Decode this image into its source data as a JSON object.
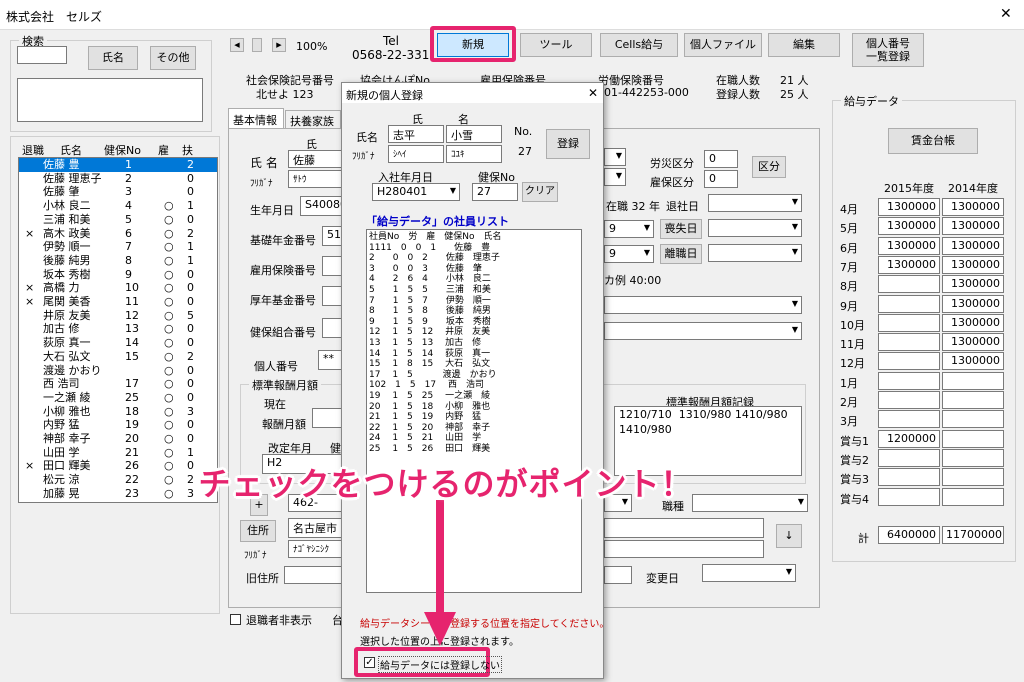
{
  "window": {
    "title": "株式会社　セルズ",
    "close": "✕"
  },
  "search": {
    "label": "検索",
    "name_btn": "氏名",
    "other_btn": "その他"
  },
  "staff_list": {
    "headers": [
      "退職",
      "氏名",
      "健保No",
      "雇",
      "扶"
    ],
    "rows": [
      {
        "ret": "",
        "name": "佐藤 豊",
        "no": "1",
        "koyo": "",
        "fu": "2"
      },
      {
        "ret": "",
        "name": "佐藤 理恵子",
        "no": "2",
        "koyo": "",
        "fu": "0"
      },
      {
        "ret": "",
        "name": "佐藤 肇",
        "no": "3",
        "koyo": "",
        "fu": "0"
      },
      {
        "ret": "",
        "name": "小林 良二",
        "no": "4",
        "koyo": "○",
        "fu": "1"
      },
      {
        "ret": "",
        "name": "三浦 和美",
        "no": "5",
        "koyo": "○",
        "fu": "0"
      },
      {
        "ret": "×",
        "name": "高木 政美",
        "no": "6",
        "koyo": "○",
        "fu": "2"
      },
      {
        "ret": "",
        "name": "伊勢 順一",
        "no": "7",
        "koyo": "○",
        "fu": "1"
      },
      {
        "ret": "",
        "name": "後藤 純男",
        "no": "8",
        "koyo": "○",
        "fu": "1"
      },
      {
        "ret": "",
        "name": "坂本 秀樹",
        "no": "9",
        "koyo": "○",
        "fu": "0"
      },
      {
        "ret": "×",
        "name": "高橋 力",
        "no": "10",
        "koyo": "○",
        "fu": "0"
      },
      {
        "ret": "×",
        "name": "尾関 美香",
        "no": "11",
        "koyo": "○",
        "fu": "0"
      },
      {
        "ret": "",
        "name": "井原 友美",
        "no": "12",
        "koyo": "○",
        "fu": "5"
      },
      {
        "ret": "",
        "name": "加古 修",
        "no": "13",
        "koyo": "○",
        "fu": "0"
      },
      {
        "ret": "",
        "name": "荻原 真一",
        "no": "14",
        "koyo": "○",
        "fu": "0"
      },
      {
        "ret": "",
        "name": "大石 弘文",
        "no": "15",
        "koyo": "○",
        "fu": "2"
      },
      {
        "ret": "",
        "name": "渡邊 かおり",
        "no": "",
        "koyo": "○",
        "fu": "0"
      },
      {
        "ret": "",
        "name": "西 浩司",
        "no": "17",
        "koyo": "○",
        "fu": "0"
      },
      {
        "ret": "",
        "name": "一之瀬 綾",
        "no": "25",
        "koyo": "○",
        "fu": "0"
      },
      {
        "ret": "",
        "name": "小柳 雅也",
        "no": "18",
        "koyo": "○",
        "fu": "3"
      },
      {
        "ret": "",
        "name": "内野 猛",
        "no": "19",
        "koyo": "○",
        "fu": "0"
      },
      {
        "ret": "",
        "name": "神部 幸子",
        "no": "20",
        "koyo": "○",
        "fu": "0"
      },
      {
        "ret": "",
        "name": "山田 学",
        "no": "21",
        "koyo": "○",
        "fu": "1"
      },
      {
        "ret": "×",
        "name": "田口 輝美",
        "no": "26",
        "koyo": "○",
        "fu": "0"
      },
      {
        "ret": "",
        "name": "松元 涼",
        "no": "22",
        "koyo": "○",
        "fu": "2"
      },
      {
        "ret": "",
        "name": "加藤 晃",
        "no": "23",
        "koyo": "○",
        "fu": "3"
      }
    ]
  },
  "toolbar": {
    "zoom": "100%",
    "tel_label": "Tel",
    "tel": "0568-22-3311",
    "new": "新規",
    "tool": "ツール",
    "cells_kyuyo": "Cells給与",
    "kojin_file": "個人ファイル",
    "henshu": "編集",
    "mynumber_list": "個人番号\n一覧登録"
  },
  "insurance": {
    "shaho_label": "社会保険記号番号",
    "shaho_val": "北せよ 123",
    "kyokai_label": "協会けんぽNo",
    "koyo_label": "雇用保険番号",
    "rodo_label": "労働保険番号",
    "rodo_val": "01-442253-000",
    "zaishoku_label": "在職人数",
    "zaishoku_val": "21 人",
    "toroku_label": "登録人数",
    "toroku_val": "25 人"
  },
  "tabs": [
    "基本情報",
    "扶養家族"
  ],
  "basic": {
    "shi": "氏",
    "shimei_label": "氏 名",
    "shimei_val": "佐藤",
    "furigana_label": "ﾌﾘｶﾞﾅ",
    "furigana_val": "ｻﾄｳ",
    "seinengappi": "生年月日",
    "seinen_val": "S40080",
    "kiso_label": "基礎年金番号",
    "kiso_val": "51",
    "koyo_no": "雇用保険番号",
    "kosei_no": "厚年基金番号",
    "kenpo_kumiai": "健保組合番号",
    "kojin_no": "個人番号",
    "kojin_val": "**",
    "rosai": "労災区分",
    "rosai_val": "0",
    "koyo_kubun": "雇保区分",
    "koyo_val": "0",
    "kubun_btn": "区分",
    "zaishoku_text": "在職 32 年",
    "taishokubi": "退社日",
    "sou9": "9",
    "sousitsu": "喪失日",
    "rishoku": "離職日",
    "hyojun_text": "カ例 40:00"
  },
  "hoshu": {
    "group": "標準報酬月額",
    "genzai": "現在",
    "hoshu_getsugaku": "報酬月額",
    "kaitei": "改定年月",
    "kaitei_val": "H2",
    "ken": "健",
    "kiroku_label": "標準報酬月額記録",
    "kiroku": "1210/710  1310/980 1410/980\n1410/980"
  },
  "address": {
    "jusho_btn": "住所",
    "jusho_val": "名古屋市",
    "furi": "ﾌﾘｶﾞﾅ",
    "furi_val": "ﾅｺﾞﾔｼﾆｼｸ",
    "kyu": "旧住所",
    "zip": "462-",
    "shokushu": "職種",
    "henkobi": "変更日",
    "arrow": "↓",
    "plus": "+"
  },
  "salary": {
    "title": "給与データ",
    "ledger_btn": "賃金台帳",
    "years": [
      "2015年度",
      "2014年度"
    ],
    "rows": [
      {
        "m": "4月",
        "a": "1300000",
        "b": "1300000"
      },
      {
        "m": "5月",
        "a": "1300000",
        "b": "1300000"
      },
      {
        "m": "6月",
        "a": "1300000",
        "b": "1300000"
      },
      {
        "m": "7月",
        "a": "1300000",
        "b": "1300000"
      },
      {
        "m": "8月",
        "a": "",
        "b": "1300000"
      },
      {
        "m": "9月",
        "a": "",
        "b": "1300000"
      },
      {
        "m": "10月",
        "a": "",
        "b": "1300000"
      },
      {
        "m": "11月",
        "a": "",
        "b": "1300000"
      },
      {
        "m": "12月",
        "a": "",
        "b": "1300000"
      },
      {
        "m": "1月",
        "a": "",
        "b": ""
      },
      {
        "m": "2月",
        "a": "",
        "b": ""
      },
      {
        "m": "3月",
        "a": "",
        "b": ""
      },
      {
        "m": "賞与1",
        "a": "1200000",
        "b": ""
      },
      {
        "m": "賞与2",
        "a": "",
        "b": ""
      },
      {
        "m": "賞与3",
        "a": "",
        "b": ""
      },
      {
        "m": "賞与4",
        "a": "",
        "b": ""
      }
    ],
    "total_label": "計",
    "total_a": "6400000",
    "total_b": "11700000"
  },
  "bottom": {
    "hide_retired": "退職者非表示",
    "dai": "台"
  },
  "dialog": {
    "title": "新規の個人登録",
    "close": "✕",
    "shi": "氏",
    "mei": "名",
    "shimei": "氏名",
    "sei_val": "志平",
    "mei_val": "小雪",
    "furigana": "ﾌﾘｶﾞﾅ",
    "sei_furi": "ｼﾍｲ",
    "mei_furi": "ｺﾕｷ",
    "no_label": "No.",
    "no_val": "27",
    "register": "登録",
    "nyusha_label": "入社年月日",
    "nyusha_val": "H280401",
    "kenpo_label": "健保No",
    "kenpo_val": "27",
    "clear": "クリア",
    "list_title": "「給与データ」の社員リスト",
    "list_header": "社員No　労　雇　健保No　氏名",
    "list_rows": [
      "1111　0　0　1　　佐藤　豊",
      "2　　0　0　2　　佐藤　理恵子",
      "3　　0　0　3　　佐藤　肇",
      "4　　2　6　4　　小林　良二",
      "5　　1　5　5　　三浦　和美",
      "7　　1　5　7　　伊勢　順一",
      "8　　1　5　8　　後藤　純男",
      "9　　1　5　9　　坂本　秀樹",
      "12　 1　5　12　 井原　友美",
      "13　 1　5　13　 加古　修",
      "14　 1　5　14　 荻原　真一",
      "15　 1　8　15　 大石　弘文",
      "17　 1　5　　　 渡邊　かおり",
      "102　1　5　17　 西　浩司",
      "19　 1　5　25　 一之瀬　綾",
      "20　 1　5　18　 小柳　雅也",
      "21　 1　5　19　 内野　猛",
      "22　 1　5　20　 神部　幸子",
      "24　 1　5　21　 山田　学",
      "25　 1　5　26　 田口　輝美"
    ],
    "note": "給与データシートに登録する位置を指定してください。",
    "note2": "選択した位置の上に登録されます。",
    "checkbox": "給与データには登録しない"
  },
  "annotation": {
    "callout": "チェックをつけるのがポイント！",
    "accent": "#e6246e"
  }
}
